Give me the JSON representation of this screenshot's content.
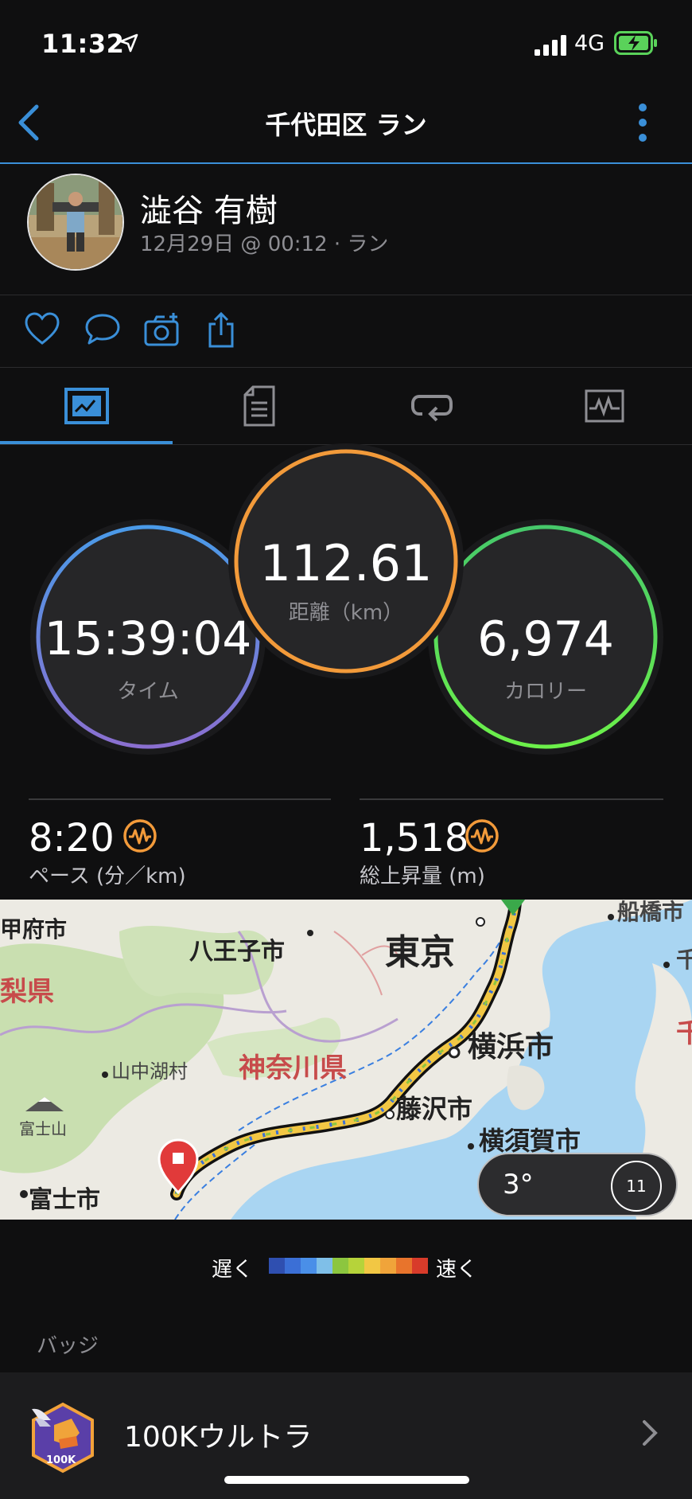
{
  "status": {
    "time": "11:32",
    "network": "4G"
  },
  "nav": {
    "title": "千代田区 ラン"
  },
  "user": {
    "name": "澁谷 有樹",
    "meta": "12月29日 @ 00:12 · ラン"
  },
  "stats": {
    "distance": {
      "value": "112.61",
      "label": "距離（km）"
    },
    "time": {
      "value": "15:39:04",
      "label": "タイム"
    },
    "calories": {
      "value": "6,974",
      "label": "カロリー"
    }
  },
  "metrics": {
    "pace": {
      "value": "8:20",
      "label": "ペース (分／km)"
    },
    "ascent": {
      "value": "1,518",
      "label": "総上昇量 (m)"
    }
  },
  "map": {
    "labels": {
      "kofu": "甲府市",
      "hachioji": "八王子市",
      "tokyo": "東京",
      "funabashi": "船橋市",
      "chiba": "千",
      "yamanashi": "梨県",
      "yamanakako": "山中湖村",
      "kanagawa": "神奈川県",
      "yokohama": "横浜市",
      "fuji_mt": "富士山",
      "fujisawa": "藤沢市",
      "yokosuka": "横須賀市",
      "fuji_city": "富士市",
      "chiba_pref": "千"
    },
    "weather": {
      "temp": "3°",
      "wind": "11"
    }
  },
  "legend": {
    "slow": "遅く",
    "fast": "速く",
    "colors": [
      "#2f4fb0",
      "#3b6fd6",
      "#4a8fe8",
      "#7fbfe8",
      "#8cc63f",
      "#b6d33a",
      "#f2c744",
      "#f0a43a",
      "#e8742c",
      "#d83b2a"
    ]
  },
  "badges": {
    "header": "バッジ",
    "item": {
      "name": "100Kウルトラ",
      "emblem_text": "100K"
    }
  }
}
